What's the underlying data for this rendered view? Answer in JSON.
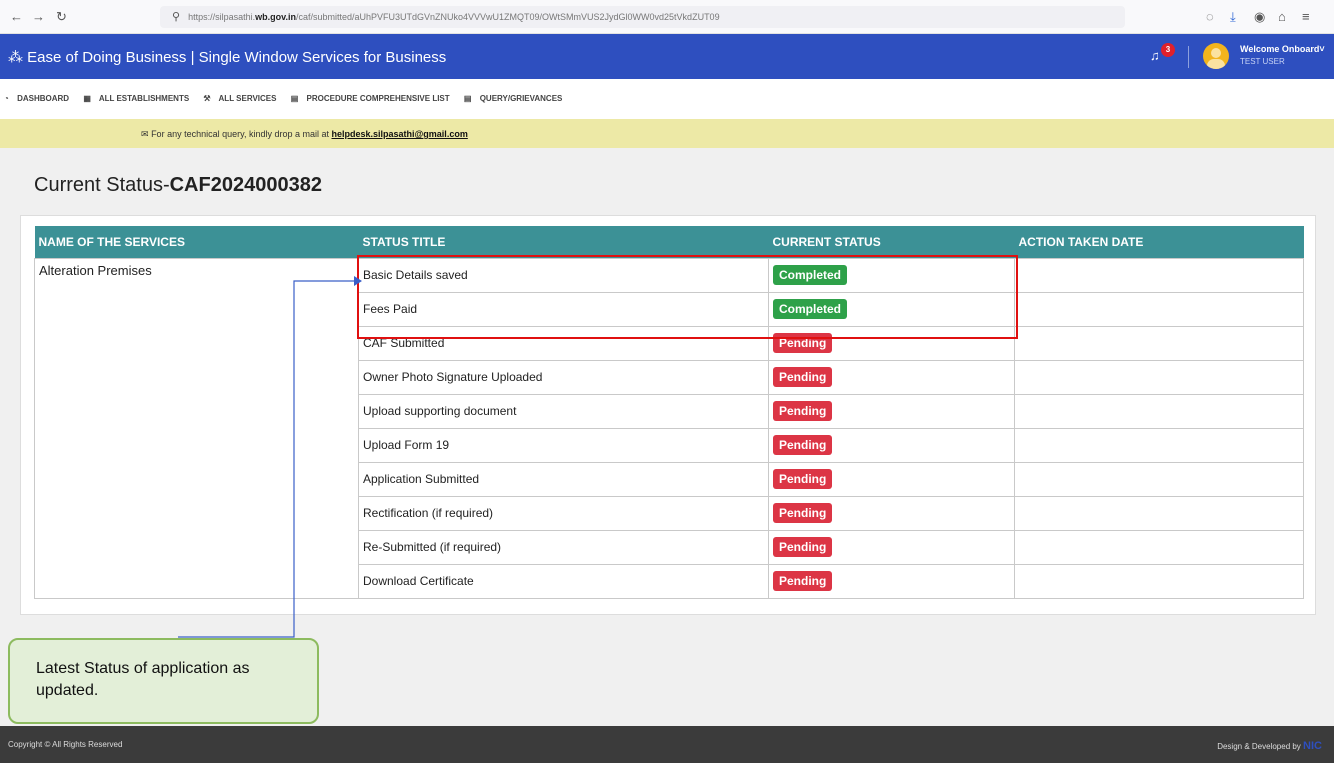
{
  "browser": {
    "url_prefix": "https://silpasathi.",
    "url_domain": "wb.gov.in",
    "url_rest": "/caf/submitted/aUhPVFU3UTdGVnZNUko4VVVwU1ZMQT09/OWtSMmVUS2JydGl0WW0vd25tVkdZUT09"
  },
  "header": {
    "title": "Ease of Doing Business | Single Window Services for Business",
    "notification_count": "3",
    "welcome": "Welcome Onboard",
    "user": "TEST USER"
  },
  "nav": {
    "dashboard": "DASHBOARD",
    "establishments": "ALL ESTABLISHMENTS",
    "services": "ALL SERVICES",
    "procedure": "PROCEDURE COMPREHENSIVE LIST",
    "query": "QUERY/GRIEVANCES"
  },
  "notice": {
    "text": "For any technical query, kindly drop a mail at",
    "email": "helpdesk.silpasathi@gmail.com"
  },
  "page": {
    "title_prefix": "Current Status-",
    "caf_id": "CAF2024000382"
  },
  "table": {
    "headers": [
      "NAME OF THE SERVICES",
      "STATUS TITLE",
      "CURRENT STATUS",
      "ACTION TAKEN DATE"
    ],
    "service_name": "Alteration Premises",
    "rows": [
      {
        "title": "Basic Details saved",
        "status": "Completed",
        "date": ""
      },
      {
        "title": "Fees Paid",
        "status": "Completed",
        "date": ""
      },
      {
        "title": "CAF Submitted",
        "status": "Pending",
        "date": ""
      },
      {
        "title": "Owner Photo Signature Uploaded",
        "status": "Pending",
        "date": ""
      },
      {
        "title": "Upload supporting document",
        "status": "Pending",
        "date": ""
      },
      {
        "title": "Upload Form 19",
        "status": "Pending",
        "date": ""
      },
      {
        "title": "Application Submitted",
        "status": "Pending",
        "date": ""
      },
      {
        "title": "Rectification (if required)",
        "status": "Pending",
        "date": ""
      },
      {
        "title": "Re-Submitted (if required)",
        "status": "Pending",
        "date": ""
      },
      {
        "title": "Download Certificate",
        "status": "Pending",
        "date": ""
      }
    ]
  },
  "callout": {
    "text": "Latest Status of application as updated."
  },
  "footer": {
    "left": "Copyright © All Rights Reserved",
    "right": "Design & Developed by",
    "brand": "NIC"
  },
  "colors": {
    "header_blue": "#2e4fbf",
    "table_header_teal": "#3c9196",
    "completed_green": "#2ea149",
    "pending_red": "#dc3545",
    "highlight_red": "#e01010"
  }
}
